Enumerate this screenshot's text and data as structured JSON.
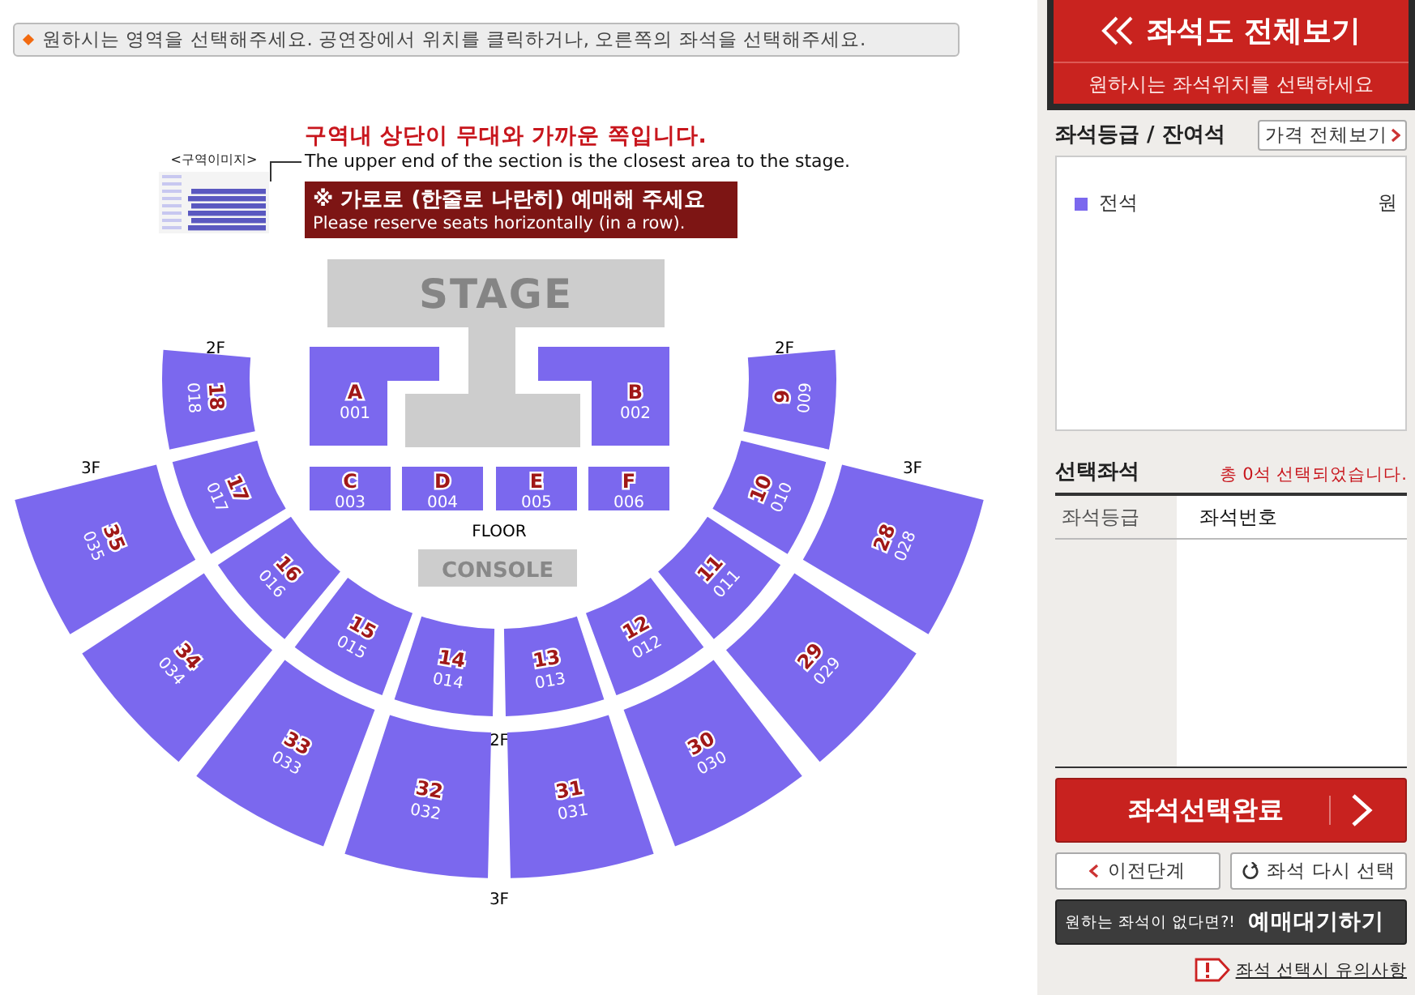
{
  "notice": "원하시는 영역을 선택해주세요. 공연장에서 위치를 클릭하거나, 오른쪽의 좌석을 선택해주세요.",
  "legend": {
    "image_label": "<구역이미지>",
    "title": "구역내 상단이 무대와 가까운 쪽입니다.",
    "subtitle": "The upper end of the section is the closest area to the stage.",
    "note_title": "※ 가로로 (한줄로 나란히) 예매해 주세요",
    "note_subtitle": "Please reserve seats horizontally (in a row)."
  },
  "map": {
    "stage": "STAGE",
    "floor_label": "FLOOR",
    "console": "CONSOLE",
    "floor_sections": [
      {
        "letter": "A",
        "code": "001"
      },
      {
        "letter": "B",
        "code": "002"
      },
      {
        "letter": "C",
        "code": "003"
      },
      {
        "letter": "D",
        "code": "004"
      },
      {
        "letter": "E",
        "code": "005"
      },
      {
        "letter": "F",
        "code": "006"
      }
    ],
    "rings": [
      {
        "labels": [
          "2F",
          "2F",
          "2F"
        ],
        "sections": [
          {
            "number": "18",
            "code": "018"
          },
          {
            "number": "17",
            "code": "017"
          },
          {
            "number": "16",
            "code": "016"
          },
          {
            "number": "15",
            "code": "015"
          },
          {
            "number": "14",
            "code": "014"
          },
          {
            "number": "13",
            "code": "013"
          },
          {
            "number": "12",
            "code": "012"
          },
          {
            "number": "11",
            "code": "011"
          },
          {
            "number": "10",
            "code": "010"
          },
          {
            "number": "9",
            "code": "009"
          }
        ]
      },
      {
        "labels": [
          "3F",
          "3F",
          "3F"
        ],
        "sections": [
          {
            "number": "35",
            "code": "035"
          },
          {
            "number": "34",
            "code": "034"
          },
          {
            "number": "33",
            "code": "033"
          },
          {
            "number": "32",
            "code": "032"
          },
          {
            "number": "31",
            "code": "031"
          },
          {
            "number": "30",
            "code": "030"
          },
          {
            "number": "29",
            "code": "029"
          },
          {
            "number": "28",
            "code": "028"
          }
        ]
      }
    ]
  },
  "panel": {
    "header_title": "좌석도 전체보기",
    "header_subtitle": "원하시는 좌석위치를 선택하세요",
    "grades_title": "좌석등급 / 잔여석",
    "price_button": "가격 전체보기",
    "grades": [
      {
        "name": "전석",
        "price": "원",
        "color": "#7b68ee"
      }
    ],
    "selected_title": "선택좌석",
    "selected_summary": "총 0석 선택되었습니다.",
    "table_columns": [
      "좌석등급",
      "좌석번호"
    ],
    "complete_button": "좌석선택완료",
    "prev_button": "이전단계",
    "reset_button": "좌석 다시 선택",
    "waitlist_prompt": "원하는 좌석이 없다면?!",
    "waitlist_button": "예매대기하기",
    "caution_link": "좌석 선택시 유의사항"
  }
}
